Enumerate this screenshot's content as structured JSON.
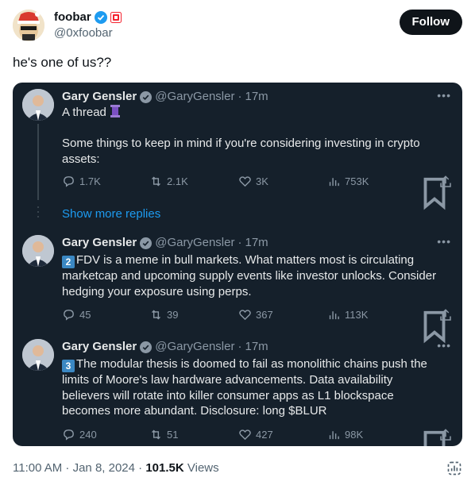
{
  "author": {
    "display_name": "foobar",
    "handle": "@0xfoobar",
    "follow_label": "Follow"
  },
  "tweet": {
    "text": "he's one of us??",
    "timestamp": "11:00 AM · Jan 8, 2024 ·",
    "views_count": "101.5K",
    "views_label": "Views"
  },
  "quoted": {
    "show_more": "Show more replies",
    "posts": [
      {
        "name": "Gary Gensler",
        "handle": "@GaryGensler",
        "time": "17m",
        "line1": "A thread",
        "line2": "Some things to keep in mind if you're considering investing in crypto assets:",
        "replies": "1.7K",
        "reposts": "2.1K",
        "likes": "3K",
        "views": "753K"
      },
      {
        "name": "Gary Gensler",
        "handle": "@GaryGensler",
        "time": "17m",
        "badge": "2",
        "body": "FDV is a meme in bull markets. What matters most is circulating marketcap and upcoming supply events like investor unlocks. Consider hedging your exposure using perps.",
        "replies": "45",
        "reposts": "39",
        "likes": "367",
        "views": "113K"
      },
      {
        "name": "Gary Gensler",
        "handle": "@GaryGensler",
        "time": "17m",
        "badge": "3",
        "body": "The modular thesis is doomed to fail as monolithic chains push the limits of Moore's law hardware advancements. Data availability believers will rotate into killer consumer apps as L1 blockspace becomes more abundant. Disclosure: long $BLUR",
        "replies": "240",
        "reposts": "51",
        "likes": "427",
        "views": "98K"
      }
    ]
  },
  "colors": {
    "verified": "#1d9bf0",
    "link": "#1d9bf0",
    "card_bg": "#15202b"
  }
}
